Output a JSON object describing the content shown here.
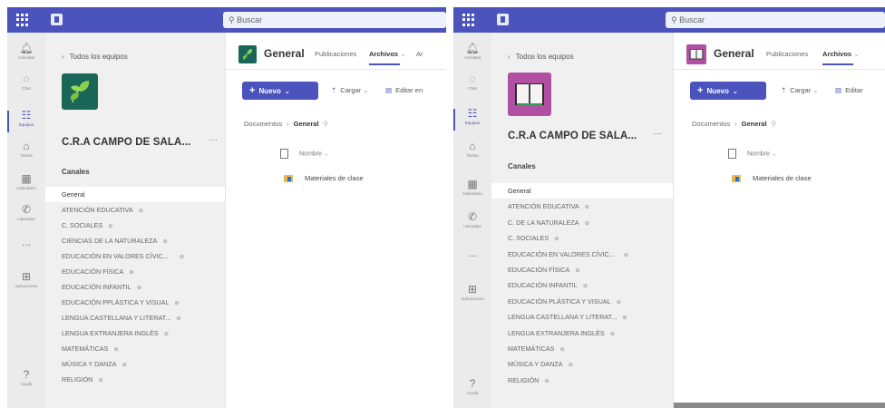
{
  "left": {
    "search_placeholder": "Buscar",
    "rail": [
      {
        "label": "Actividad",
        "icon": "bell-icon"
      },
      {
        "label": "Chat",
        "icon": "chat-icon"
      },
      {
        "label": "Equipos",
        "icon": "teams-icon"
      },
      {
        "label": "Tareas",
        "icon": "assignments-icon"
      },
      {
        "label": "Calendario",
        "icon": "calendar-icon"
      },
      {
        "label": "Llamadas",
        "icon": "phone-icon"
      },
      {
        "label": "...",
        "icon": "more-icon"
      },
      {
        "label": "Aplicaciones",
        "icon": "apps-icon"
      },
      {
        "label": "Ayuda",
        "icon": "help-icon"
      }
    ],
    "back_label": "Todos los equipos",
    "team_name": "C.R.A CAMPO DE SALA...",
    "more": "···",
    "channels_heading": "Canales",
    "channels": [
      "General",
      "ATENCIÓN EDUCATIVA",
      "C. SOCIALES",
      "CIENCIAS DE LA NATURALEZA",
      "EDUCACIÓN EN VALORES CÍVIC...",
      "EDUCACIÓN FÍSICA",
      "EDUCACIÓN INFANTIL",
      "EDUCACIÓN PPLÁSTICA Y VISUAL",
      "LENGUA CASTELLANA Y LITERAT...",
      "LENGUA EXTRANJERA INGLÉS",
      "MATEMÁTICAS",
      "MÚSICA Y DANZA",
      "RELIGIÓN"
    ],
    "channel_title": "General",
    "tabs": [
      "Publicaciones",
      "Archivos",
      "Ar"
    ],
    "new_button": "Nuevo",
    "upload": "Cargar",
    "edit": "Editar en",
    "breadcrumb_root": "Documentos",
    "breadcrumb_current": "General",
    "column_name": "Nombre",
    "folder_name": "Materiales de clase"
  },
  "right": {
    "search_placeholder": "Buscar",
    "rail": [
      {
        "label": "Actividad",
        "icon": "bell-icon"
      },
      {
        "label": "Chat",
        "icon": "chat-icon"
      },
      {
        "label": "Equipos",
        "icon": "teams-icon"
      },
      {
        "label": "Tareas",
        "icon": "assignments-icon"
      },
      {
        "label": "Calendario",
        "icon": "calendar-icon"
      },
      {
        "label": "Llamadas",
        "icon": "phone-icon"
      },
      {
        "label": "...",
        "icon": "more-icon"
      },
      {
        "label": "Aplicaciones",
        "icon": "apps-icon"
      },
      {
        "label": "Ayuda",
        "icon": "help-icon"
      }
    ],
    "back_label": "Todos los equipos",
    "team_name": "C.R.A CAMPO DE SALA...",
    "more": "···",
    "channels_heading": "Canales",
    "channels": [
      "General",
      "ATENCIÓN EDUCATIVA",
      "C. DE LA NATURALEZA",
      "C. SOCIALES",
      "EDUCACIÓN EN VALORES CÍVIC...",
      "EDUCACIÓN FÍSICA",
      "EDUCACIÓN INFANTIL",
      "EDUCACIÓN PLÁSTICA Y VISUAL",
      "LENGUA CASTELLANA Y LITERAT...",
      "LENGUA EXTRANJERA INGLÉS",
      "MATEMÁTICAS",
      "MÚSICA Y DANZA",
      "RELIGIÓN"
    ],
    "channel_title": "General",
    "tabs": [
      "Publicaciones",
      "Archivos"
    ],
    "new_button": "Nuevo",
    "upload": "Cargar",
    "edit": "Editar",
    "breadcrumb_root": "Documentos",
    "breadcrumb_current": "General",
    "column_name": "Nombre",
    "folder_name": "Materiales de clase"
  },
  "colors": {
    "brand": "#4b53bc",
    "team_avatar_left": "#1a6658",
    "team_avatar_right": "#b14fa2"
  }
}
